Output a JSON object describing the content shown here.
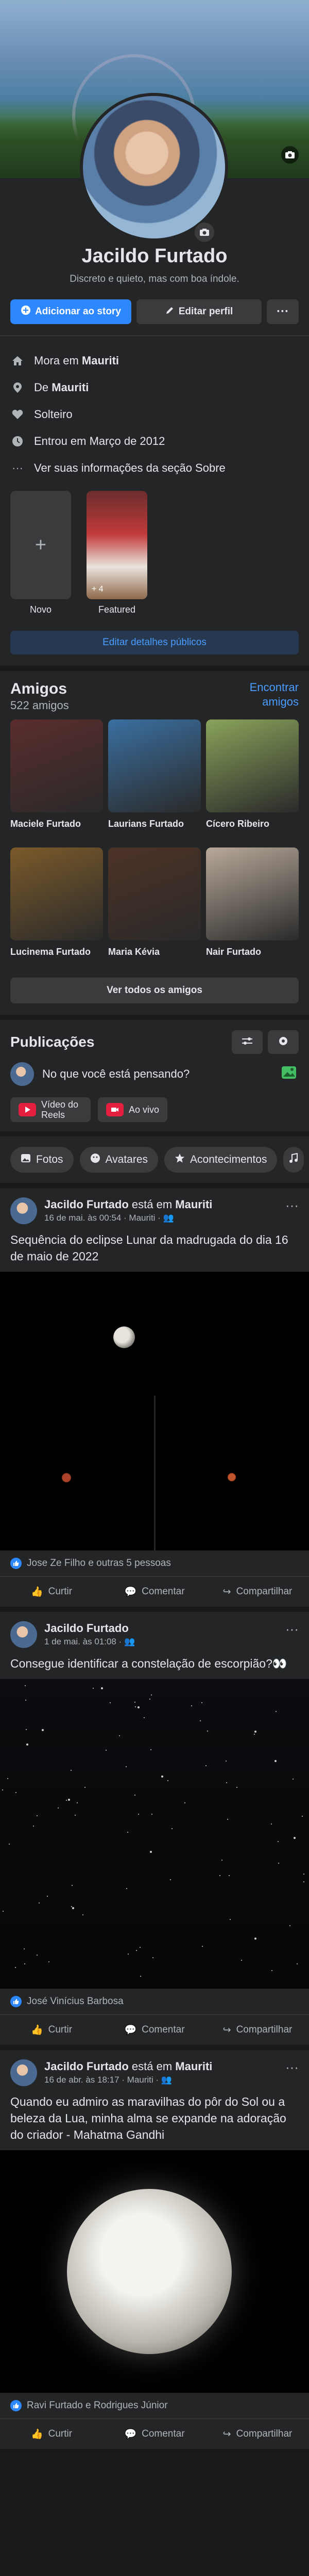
{
  "profile": {
    "name": "Jacildo Furtado",
    "bio": "Discreto e quieto, mas com boa índole.",
    "add_story_label": "Adicionar ao story",
    "edit_profile_label": "Editar perfil",
    "more_label": "···"
  },
  "about": {
    "lives_prefix": "Mora em ",
    "lives_city": "Mauriti",
    "from_prefix": "De ",
    "from_city": "Mauriti",
    "relationship": "Solteiro",
    "joined": "Entrou em Março de 2012",
    "see_about": "Ver suas informações da seção Sobre"
  },
  "featured": {
    "new_label": "Novo",
    "new_symbol": "+",
    "featured_label": "Featured",
    "featured_count": "+ 4",
    "edit_public": "Editar detalhes públicos"
  },
  "friends": {
    "title": "Amigos",
    "count": "522 amigos",
    "find_link": "Encontrar amigos",
    "list": [
      {
        "name": "Maciele Furtado",
        "color": "#5a2c2c"
      },
      {
        "name": "Laurians Furtado",
        "color": "#3a6fa0"
      },
      {
        "name": "Cícero Ribeiro",
        "color": "#8aa35a"
      },
      {
        "name": "Lucinema Furtado",
        "color": "#7b5a2a"
      },
      {
        "name": "Maria Kévia",
        "color": "#4d3226"
      },
      {
        "name": "Nair Furtado",
        "color": "#b8a99a"
      }
    ],
    "see_all": "Ver todos os amigos"
  },
  "publications": {
    "title": "Publicações",
    "composer_placeholder": "No que você está pensando?",
    "reels_label": "Vídeo do Reels",
    "live_label": "Ao vivo"
  },
  "filters": [
    "Fotos",
    "Avatares",
    "Acontecimentos"
  ],
  "posts": [
    {
      "author": "Jacildo Furtado",
      "connector": " está em ",
      "place": "Mauriti",
      "time": "16 de mai. às 00:54 · Mauriti · ",
      "text": "Sequência do eclipse Lunar da madrugada do dia 16 de maio de 2022",
      "reactions": "Jose Ze Filho e outras 5 pessoas"
    },
    {
      "author": "Jacildo Furtado",
      "connector": "",
      "place": "",
      "time": "1 de mai. às 01:08 · ",
      "text": "Consegue identificar a constelação de escorpião?👀",
      "reactions": "José Vinícius Barbosa"
    },
    {
      "author": "Jacildo Furtado",
      "connector": " está em ",
      "place": "Mauriti",
      "time": "16 de abr. às 18:17 · Mauriti · ",
      "text": "Quando eu admiro as maravilhas do pôr do Sol ou a beleza da Lua, minha alma se expande na adoração do criador - Mahatma Gandhi",
      "reactions": "Ravi Furtado e Rodrigues Júnior"
    }
  ],
  "post_actions": {
    "like": "Curtir",
    "comment": "Comentar",
    "share": "Compartilhar"
  },
  "colors": {
    "background": "#18191a",
    "card": "#242526",
    "accent": "#2d88ff",
    "text": "#e4e6eb",
    "muted": "#b0b3b8"
  }
}
